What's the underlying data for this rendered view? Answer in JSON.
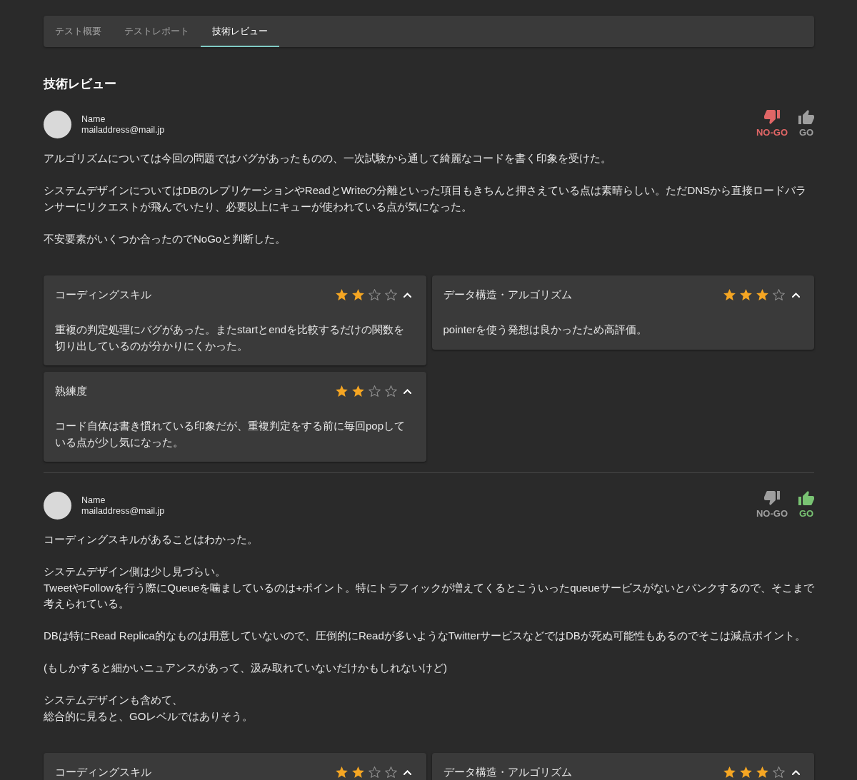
{
  "tabs": [
    {
      "label": "テスト概要",
      "selected": false
    },
    {
      "label": "テストレポート",
      "selected": false
    },
    {
      "label": "技術レビュー",
      "selected": true
    }
  ],
  "heading": "技術レビュー",
  "reviews": [
    {
      "reviewer": {
        "name": "Name",
        "email": "mailaddress@mail.jp"
      },
      "verdict": [
        {
          "kind": "no-go",
          "label": "NO-GO",
          "selected": true
        },
        {
          "kind": "go",
          "label": "GO",
          "selected": false
        }
      ],
      "paragraphs": [
        [
          "アルゴリズムについては今回の問題ではバグがあったものの、一次試験から通して綺麗なコードを書く印象を受けた。"
        ],
        [
          "システムデザインについてはDBのレプリケーションやReadとWriteの分離といった項目もきちんと押さえている点は素晴らしい。ただDNSから直接ロードバランサーにリクエストが飛んでいたり、必要以上にキューが使われている点が気になった。"
        ],
        [
          "不安要素がいくつか合ったのでNoGoと判断した。"
        ]
      ],
      "skills": [
        {
          "title": "コーディングスキル",
          "stars": 2,
          "expanded": true,
          "comment": "重複の判定処理にバグがあった。またstartとendを比較するだけの関数を切り出しているのが分かりにくかった。"
        },
        {
          "title": "データ構造・アルゴリズム",
          "stars": 3,
          "expanded": true,
          "comment": "pointerを使う発想は良かったため高評価。"
        },
        {
          "title": "熟練度",
          "stars": 2,
          "expanded": true,
          "comment": "コード自体は書き慣れている印象だが、重複判定をする前に毎回popしている点が少し気になった。"
        }
      ]
    },
    {
      "reviewer": {
        "name": "Name",
        "email": "mailaddress@mail.jp"
      },
      "verdict": [
        {
          "kind": "no-go",
          "label": "NO-GO",
          "selected": false
        },
        {
          "kind": "go",
          "label": "GO",
          "selected": true
        }
      ],
      "paragraphs": [
        [
          "コーディングスキルがあることはわかった。"
        ],
        [
          "システムデザイン側は少し見づらい。",
          "TweetやFollowを行う際にQueueを噛ましているのは+ポイント。特にトラフィックが増えてくるとこういったqueueサービスがないとパンクするので、そこまで考えられている。"
        ],
        [
          "DBは特にRead Replica的なものは用意していないので、圧倒的にReadが多いようなTwitterサービスなどではDBが死ぬ可能性もあるのでそこは減点ポイント。"
        ],
        [
          "(もしかすると細かいニュアンスがあって、汲み取れていないだけかもしれないけど)"
        ],
        [
          "システムデザインも含めて、",
          "総合的に見ると、GOレベルではありそう。"
        ]
      ],
      "skills": [
        {
          "title": "コーディングスキル",
          "stars": 2,
          "expanded": true
        },
        {
          "title": "データ構造・アルゴリズム",
          "stars": 3,
          "expanded": true
        }
      ]
    }
  ]
}
